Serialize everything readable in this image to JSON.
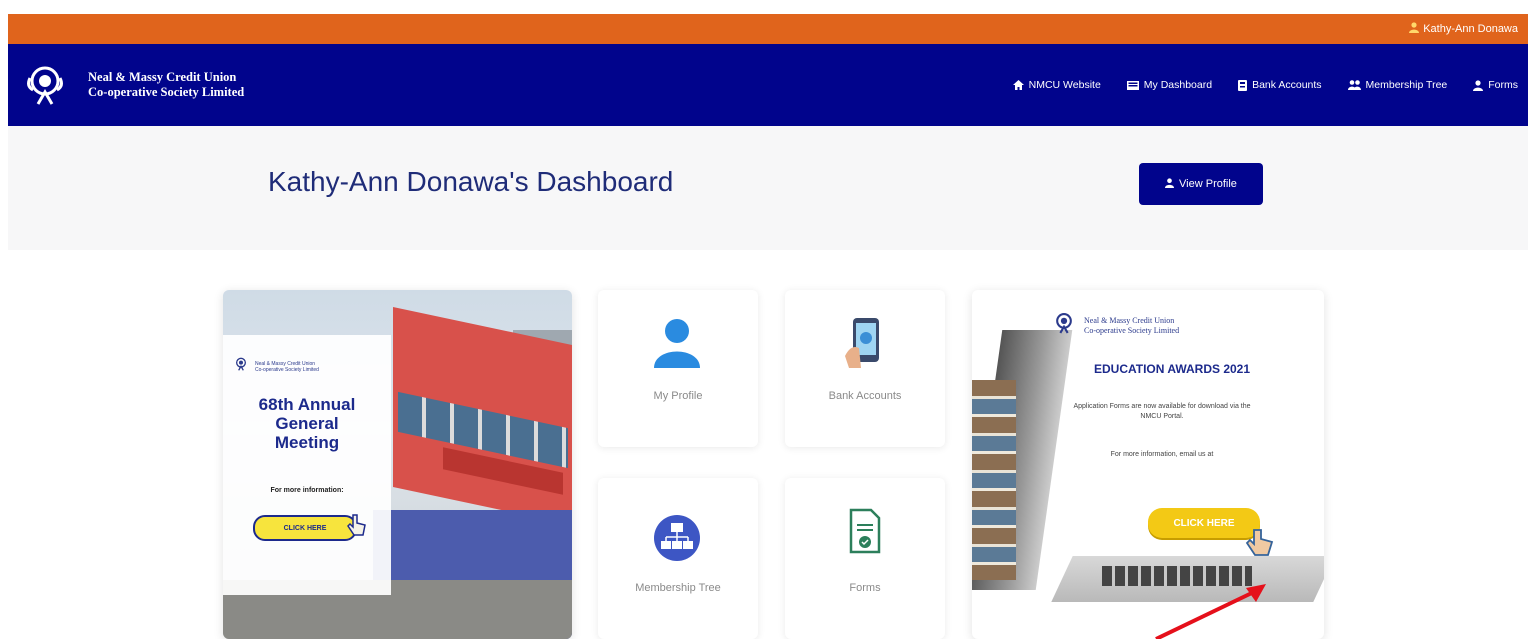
{
  "topbar": {
    "user_name": "Kathy-Ann Donawa"
  },
  "brand": {
    "line1": "Neal & Massy Credit Union",
    "line2": "Co-operative Society Limited"
  },
  "nav": {
    "items": [
      {
        "label": "NMCU Website",
        "icon": "home-icon"
      },
      {
        "label": "My Dashboard",
        "icon": "dashboard-icon"
      },
      {
        "label": "Bank Accounts",
        "icon": "bank-icon"
      },
      {
        "label": "Membership Tree",
        "icon": "users-icon"
      },
      {
        "label": "Forms",
        "icon": "user-icon"
      }
    ]
  },
  "header": {
    "title": "Kathy-Ann Donawa's Dashboard",
    "view_profile_label": "View Profile"
  },
  "agm_banner": {
    "org_line1": "Neal & Massy Credit Union",
    "org_line2": "Co-operative Society Limited",
    "title_line1": "68th Annual",
    "title_line2": "General",
    "title_line3": "Meeting",
    "info": "For more information:",
    "cta": "CLICK HERE"
  },
  "tiles": [
    {
      "label": "My Profile",
      "icon": "person-icon"
    },
    {
      "label": "Bank Accounts",
      "icon": "mobile-banking-icon"
    },
    {
      "label": "Membership Tree",
      "icon": "membership-tree-icon"
    },
    {
      "label": "Forms",
      "icon": "forms-icon"
    }
  ],
  "awards_banner": {
    "org_line1": "Neal & Massy Credit Union",
    "org_line2": "Co-operative Society Limited",
    "title": "EDUCATION AWARDS 2021",
    "text1": "Application Forms are now available for download via the NMCU Portal.",
    "text2": "For more information, email us at",
    "cta": "CLICK HERE"
  },
  "colors": {
    "orange": "#e0641c",
    "navy": "#01048c",
    "title": "#1f2c78",
    "arrow": "#e5101b"
  }
}
